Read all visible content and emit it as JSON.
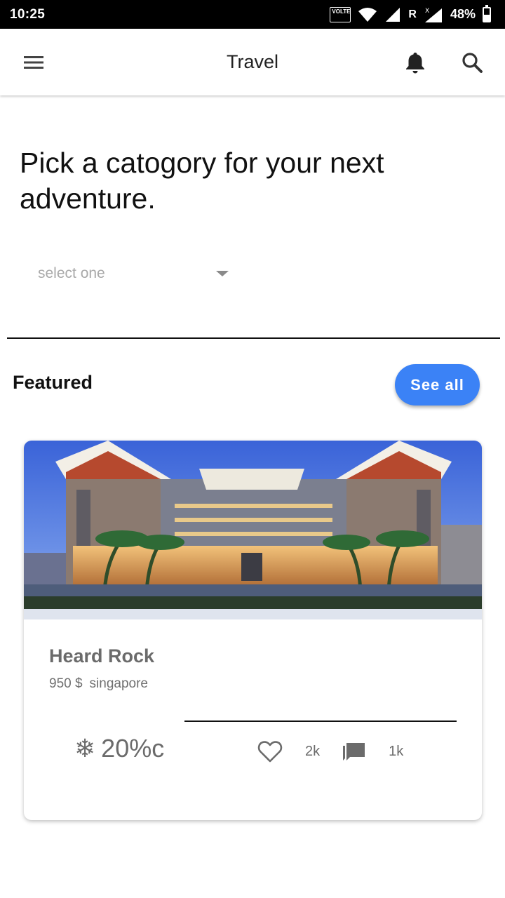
{
  "status_bar": {
    "time": "10:25",
    "volte": "VOLTE",
    "roaming": "R",
    "battery_percent": "48%",
    "battery_level": 0.48
  },
  "app_bar": {
    "title": "Travel",
    "icons": [
      "menu-icon",
      "bell-icon",
      "search-icon"
    ]
  },
  "main": {
    "heading": "Pick a catogory for your next adventure.",
    "dropdown": {
      "placeholder": "select one"
    }
  },
  "featured": {
    "label": "Featured",
    "see_all_label": "See all",
    "card": {
      "title": "Heard Rock",
      "price": "950 $",
      "location": "singapore",
      "weather_icon": "snowflake-icon",
      "temperature": "20%c",
      "likes": "2k",
      "comments": "1k"
    }
  },
  "colors": {
    "accent": "#3b82f6",
    "muted_text": "#6b6b6b",
    "placeholder": "#a9a9a9"
  }
}
